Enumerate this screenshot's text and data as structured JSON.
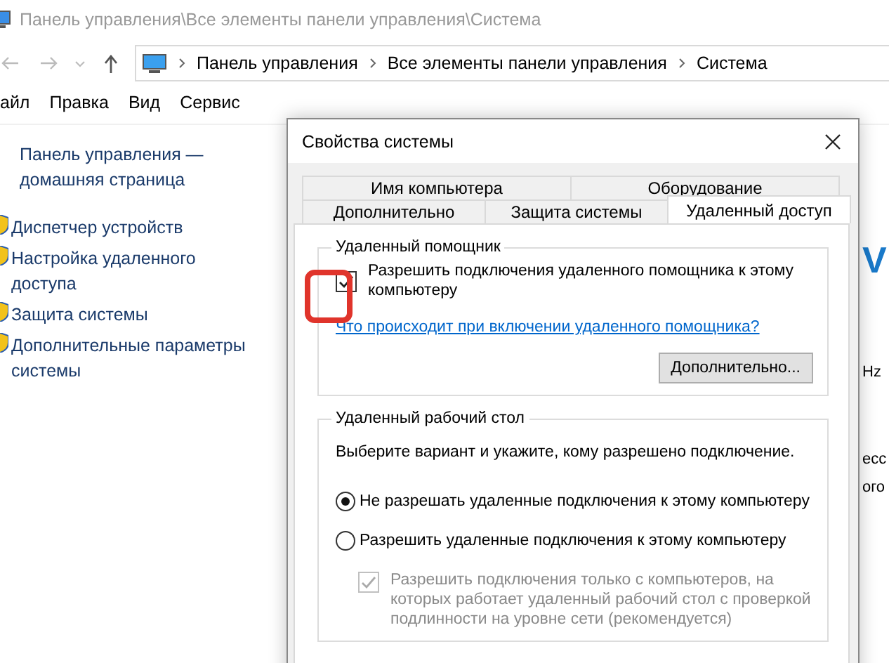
{
  "window": {
    "title": "Панель управления\\Все элементы панели управления\\Система"
  },
  "address_bar": {
    "segments": [
      "Панель управления",
      "Все элементы панели управления",
      "Система"
    ]
  },
  "menu": [
    "айл",
    "Правка",
    "Вид",
    "Сервис"
  ],
  "sidebar": {
    "home_link": "Панель управления — домашняя страница",
    "items": [
      "Диспетчер устройств",
      "Настройка удаленного доступа",
      "Защита системы",
      "Дополнительные параметры системы"
    ]
  },
  "background_fragments": [
    {
      "kind": "heading",
      "text": "V"
    },
    {
      "kind": "text",
      "text": "Hz"
    },
    {
      "kind": "text",
      "text": "есс"
    },
    {
      "kind": "text",
      "text": "ого"
    }
  ],
  "dialog": {
    "title": "Свойства системы",
    "tab_rows": [
      [
        {
          "label": "Имя компьютера",
          "selected": false
        },
        {
          "label": "Оборудование",
          "selected": false
        }
      ],
      [
        {
          "label": "Дополнительно",
          "selected": false
        },
        {
          "label": "Защита системы",
          "selected": false
        },
        {
          "label": "Удаленный доступ",
          "selected": true
        }
      ]
    ],
    "remote_assistance": {
      "title": "Удаленный помощник",
      "checkbox": {
        "label": "Разрешить подключения удаленного помощника к этому компьютеру",
        "checked": true,
        "disabled": false
      },
      "link": "Что происходит при включении удаленного помощника?",
      "button": "Дополнительно..."
    },
    "remote_desktop": {
      "title": "Удаленный рабочий стол",
      "description": "Выберите вариант и укажите, кому разрешено подключение.",
      "options": [
        {
          "label": "Не разрешать удаленные подключения к этому компьютеру",
          "selected": true
        },
        {
          "label": "Разрешить удаленные подключения к этому компьютеру",
          "selected": false
        }
      ],
      "nla_checkbox": {
        "label": "Разрешить подключения только с компьютеров, на которых работает удаленный рабочий стол с проверкой подлинности на уровне сети (рекомендуется)",
        "checked": true,
        "disabled": true
      }
    }
  }
}
